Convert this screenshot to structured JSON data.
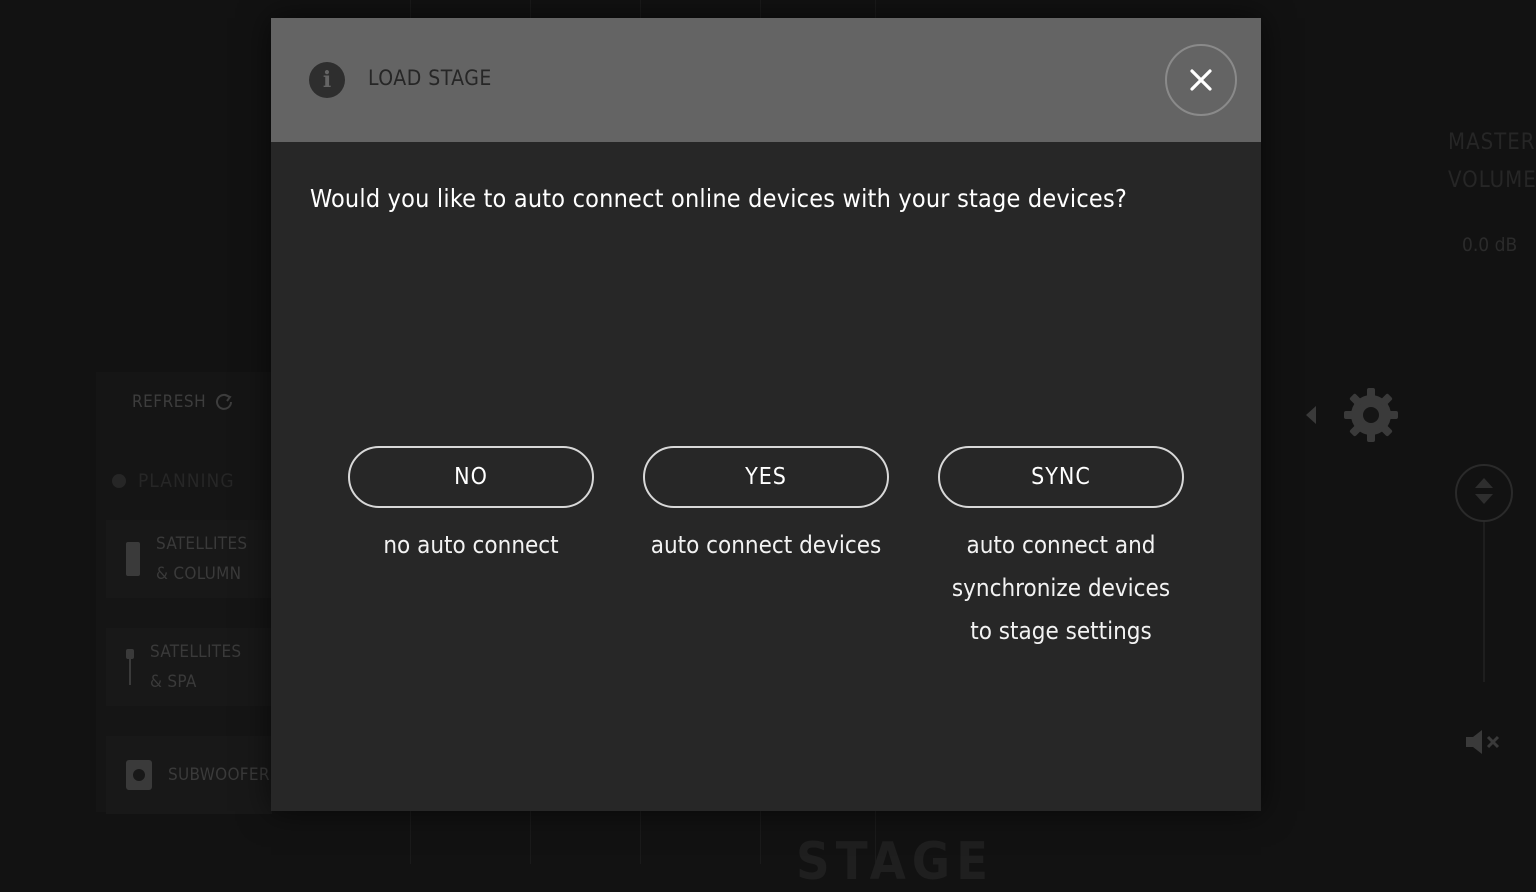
{
  "background": {
    "refresh_label": "REFRESH",
    "planning_label": "PLANNING",
    "devices": [
      {
        "label_line1": "SATELLITES",
        "label_line2": "& COLUMN"
      },
      {
        "label_line1": "SATELLITES",
        "label_line2": "& SPA"
      },
      {
        "label_line1": "SUBWOOFER",
        "label_line2": ""
      }
    ],
    "master_line1": "MASTER",
    "master_line2": "VOLUME",
    "master_value": "0.0",
    "master_unit": "dB",
    "stage_label": "STAGE"
  },
  "dialog": {
    "title": "LOAD STAGE",
    "question": "Would you like to auto connect online devices with your stage devices?",
    "options": [
      {
        "label": "NO",
        "description": "no auto connect"
      },
      {
        "label": "YES",
        "description": "auto connect devices"
      },
      {
        "label": "SYNC",
        "description": "auto connect and synchronize devices to stage settings"
      }
    ]
  },
  "icons": {
    "info": "info-icon",
    "close": "close-icon",
    "refresh": "refresh-icon",
    "gear": "gear-icon",
    "mute": "mute-icon"
  },
  "colors": {
    "header_bg": "#646464",
    "dialog_bg": "#272727",
    "page_bg": "#121212",
    "button_border": "#d8d8d8"
  }
}
